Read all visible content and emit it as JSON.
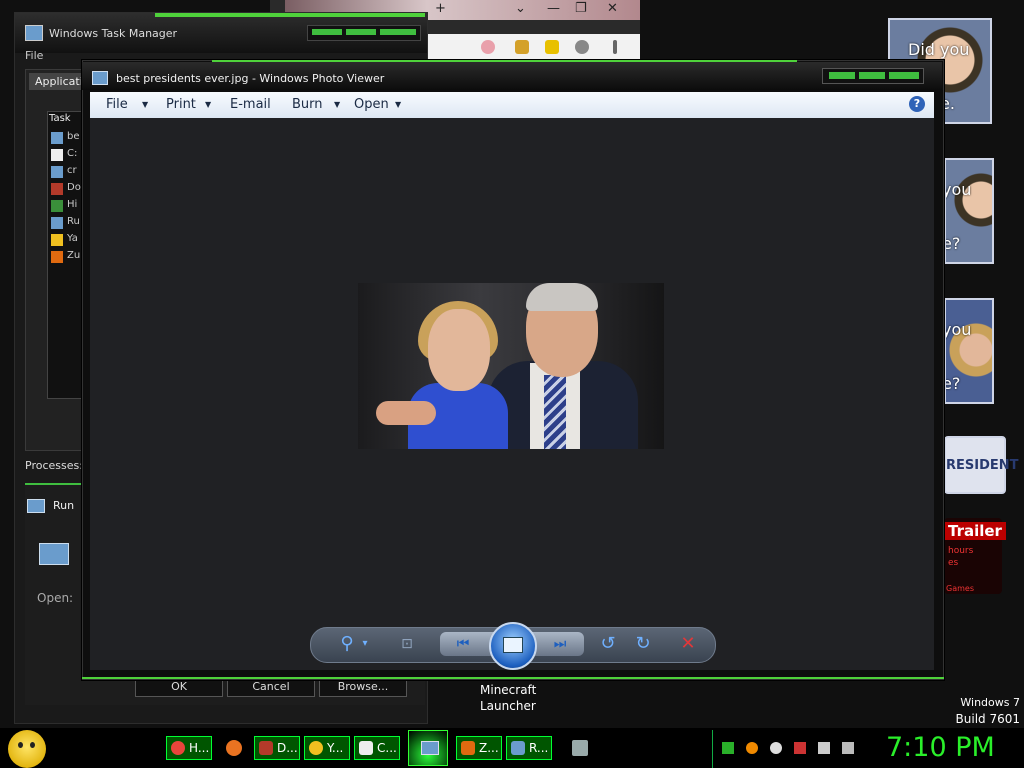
{
  "background": {
    "browser_tab_glyphs": [
      "+",
      "⌄",
      "—",
      "❐",
      "✕"
    ],
    "side_cards": [
      {
        "line1": "Did you",
        "line2": "e."
      },
      {
        "line1": "you",
        "line2": "e?"
      },
      {
        "line1": "you",
        "line2": "e?"
      }
    ],
    "president_banner": "RESIDENT",
    "trailer": {
      "title": "Trailer",
      "line1": "hours",
      "line2": "es",
      "line3": "Games"
    }
  },
  "task_manager": {
    "title": "Windows Task Manager",
    "menu_file": "File",
    "tab": "Applicatio",
    "list_header": "Task",
    "rows": [
      {
        "label": "be",
        "color": "#6a9ccc"
      },
      {
        "label": "C:",
        "color": "#eeeeee"
      },
      {
        "label": "cr",
        "color": "#6a9ccc"
      },
      {
        "label": "Do",
        "color": "#b33a2a"
      },
      {
        "label": "Hi",
        "color": "#3a8f3a"
      },
      {
        "label": "Ru",
        "color": "#6a9ccc"
      },
      {
        "label": "Ya",
        "color": "#f0c020"
      },
      {
        "label": "Zu",
        "color": "#e06a10"
      }
    ],
    "processes_label": "Processes:",
    "run": {
      "title": "Run",
      "open_label": "Open:",
      "ok": "OK",
      "cancel": "Cancel",
      "browse": "Browse..."
    }
  },
  "desktop": {
    "icon_label_line1": "Minecraft",
    "icon_label_line2": "Launcher",
    "version_line1": "Windows 7",
    "version_line2": "Build 7601"
  },
  "photo_viewer": {
    "title": "best presidents ever.jpg - Windows Photo Viewer",
    "menu": {
      "file": "File",
      "print": "Print",
      "email": "E-mail",
      "burn": "Burn",
      "open": "Open"
    },
    "help_glyph": "?",
    "controls": {
      "zoom_icon": "⚲",
      "zoom_arrow": "▾",
      "fit_icon": "⊡",
      "prev_icon": "⏮",
      "next_icon": "⏭",
      "rotate_ccw_icon": "↺",
      "rotate_cw_icon": "↻",
      "delete_icon": "✕"
    }
  },
  "taskbar": {
    "buttons": [
      {
        "label": "H...",
        "color": "#e8453c"
      },
      {
        "label": "D...",
        "color": "#b33a2a"
      },
      {
        "label": "Y...",
        "color": "#f0c020"
      },
      {
        "label": "C...",
        "color": "#eeeeee"
      },
      {
        "label": "Z...",
        "color": "#e06a10"
      },
      {
        "label": "R...",
        "color": "#6a9ccc"
      }
    ],
    "clock": "7:10 PM",
    "colors": {
      "accent": "#2aef2a",
      "border": "#00ff33"
    }
  }
}
